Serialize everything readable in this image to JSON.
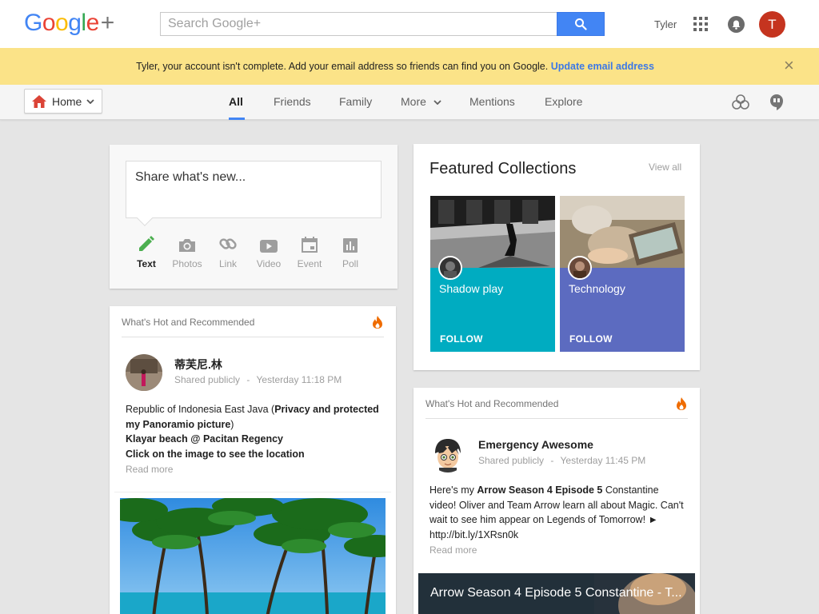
{
  "topbar": {
    "logo": {
      "g1": "G",
      "o1": "o",
      "o2": "o",
      "g2": "g",
      "l": "l",
      "e": "e",
      "plus": "+"
    },
    "search_placeholder": "Search Google+",
    "username": "Tyler",
    "avatar_letter": "T"
  },
  "banner": {
    "message": "Tyler, your account isn't complete. Add your email address so friends can find you on Google.",
    "link": "Update email address",
    "close": "×"
  },
  "nav": {
    "home_label": "Home",
    "tabs": [
      "All",
      "Friends",
      "Family",
      "More",
      "Mentions",
      "Explore"
    ]
  },
  "share": {
    "prompt": "Share what's new...",
    "tools": [
      "Text",
      "Photos",
      "Link",
      "Video",
      "Event",
      "Poll"
    ]
  },
  "post1": {
    "header": "What's Hot and Recommended",
    "author": "蒂芙尼.林",
    "visibility": "Shared publicly",
    "time": "Yesterday 11:18 PM",
    "body_plain": "Republic of Indonesia East Java (",
    "body_bold1": "Privacy and protected my Panoramio picture",
    "body_close": ")",
    "body_line2": "Klayar beach @ Pacitan Regency",
    "body_line3": "Click on the image to see the location",
    "read_more": "Read more"
  },
  "featured": {
    "title": "Featured Collections",
    "view_all": "View all",
    "collections": [
      {
        "name": "Shadow play",
        "follow": "FOLLOW",
        "color": "#00acc1"
      },
      {
        "name": "Technology",
        "follow": "FOLLOW",
        "color": "#5c6bc0"
      }
    ]
  },
  "post2": {
    "header": "What's Hot and Recommended",
    "author": "Emergency Awesome",
    "visibility": "Shared publicly",
    "time": "Yesterday 11:45 PM",
    "body_pre": "Here's my ",
    "body_bold": "Arrow Season 4 Episode 5",
    "body_post": " Constantine video! Oliver and Team Arrow learn all about Magic. Can't wait to see him appear on Legends of Tomorrow! ► http://bit.ly/1XRsn0k",
    "read_more": "Read more",
    "video_title": "Arrow Season 4 Episode 5 Constantine - T..."
  },
  "colors": {
    "accent_blue": "#4285f4",
    "banner_yellow": "#fbe388",
    "avatar_red": "#c5341f",
    "hot_orange": "#ef6c00"
  }
}
